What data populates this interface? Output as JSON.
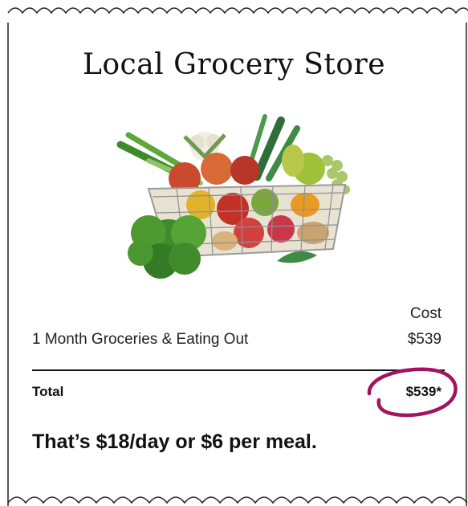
{
  "receipt": {
    "store_name": "Local Grocery Store",
    "image": "grocery-basket-image",
    "cost_header": "Cost",
    "line_items": [
      {
        "label": "1 Month Groceries & Eating Out",
        "amount": "$539"
      }
    ],
    "total_label": "Total",
    "total_amount": "$539*",
    "summary": "That’s $18/day or $6 per meal."
  },
  "colors": {
    "highlight_circle": "#a3145e",
    "border": "#222222",
    "text": "#111111"
  }
}
